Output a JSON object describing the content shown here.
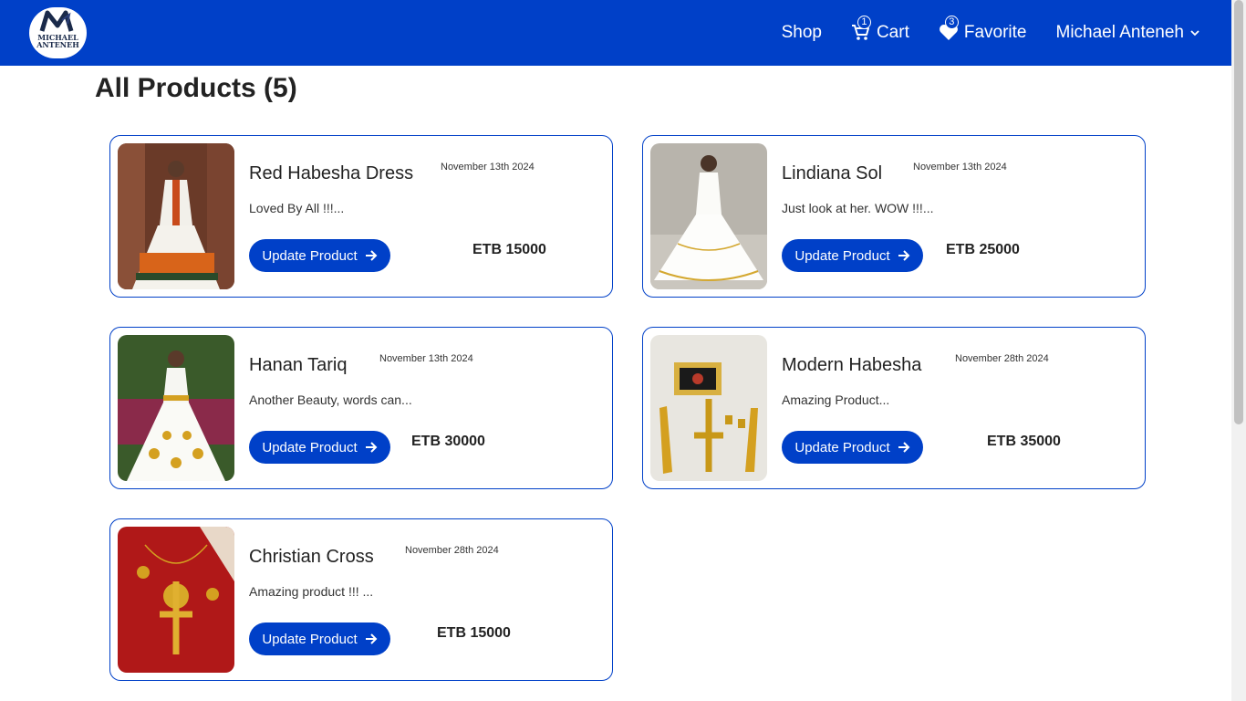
{
  "nav": {
    "logo_text_line1": "MICHAEL",
    "logo_text_line2": "ANTENEH",
    "shop": "Shop",
    "cart": "Cart",
    "cart_count": "1",
    "favorite": "Favorite",
    "favorite_count": "3",
    "user": "Michael Anteneh"
  },
  "page": {
    "title": "All Products (5)"
  },
  "products": [
    {
      "name": "Red Habesha Dress",
      "date": "November 13th 2024",
      "desc": "Loved By All !!!...",
      "button": "Update Product",
      "price": "ETB 15000"
    },
    {
      "name": "Lindiana Sol",
      "date": "November 13th 2024",
      "desc": "Just look at her. WOW !!!...",
      "button": "Update Product",
      "price": "ETB 25000"
    },
    {
      "name": "Hanan Tariq",
      "date": "November 13th 2024",
      "desc": "Another Beauty, words can...",
      "button": "Update Product",
      "price": "ETB 30000"
    },
    {
      "name": "Modern Habesha",
      "date": "November 28th 2024",
      "desc": "Amazing Product...",
      "button": "Update Product",
      "price": "ETB 35000"
    },
    {
      "name": "Christian Cross",
      "date": "November 28th 2024",
      "desc": "Amazing product !!! ...",
      "button": "Update Product",
      "price": "ETB 15000"
    }
  ],
  "colors": {
    "primary": "#0040c8",
    "text": "#222222"
  }
}
